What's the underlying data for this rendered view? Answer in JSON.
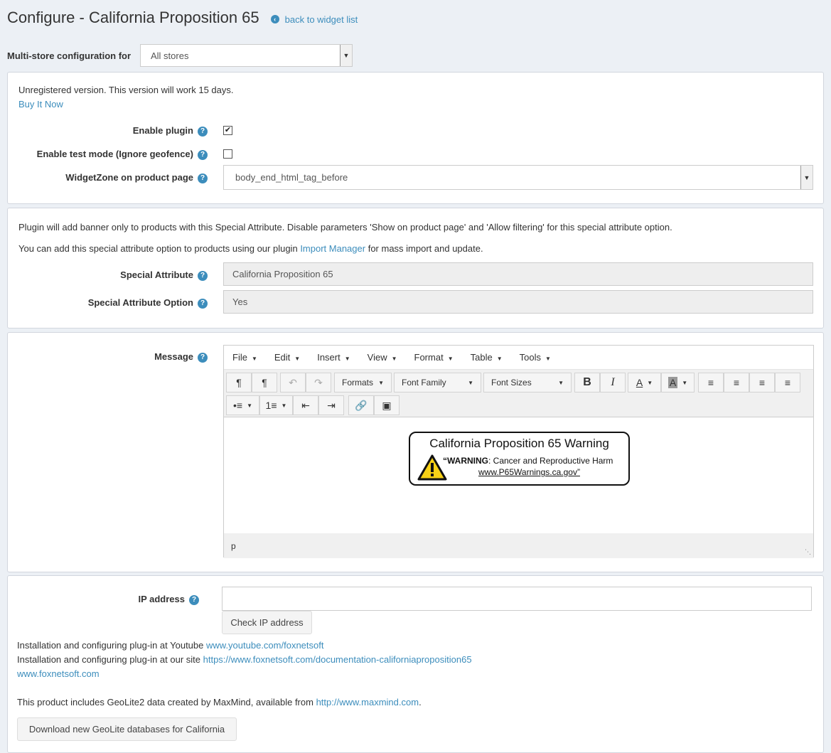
{
  "header": {
    "title": "Configure - California Proposition 65",
    "back_link": "back to widget list"
  },
  "store": {
    "label": "Multi-store configuration for",
    "value": "All stores"
  },
  "general": {
    "unregistered": "Unregistered version. This version will work 15 days.",
    "buy_now": "Buy It Now",
    "enable_plugin_label": "Enable plugin",
    "enable_plugin_checked": true,
    "test_mode_label": "Enable test mode (Ignore geofence)",
    "test_mode_checked": false,
    "widgetzone_label": "WidgetZone on product page",
    "widgetzone_value": "body_end_html_tag_before"
  },
  "attribute": {
    "info1": "Plugin will add banner only to products with this Special Attribute. Disable parameters 'Show on product page' and 'Allow filtering' for this special attribute option.",
    "info2_prefix": "You can add this special attribute option to products using our plugin",
    "info2_link": "Import Manager",
    "info2_suffix": "for mass import and update.",
    "special_attr_label": "Special Attribute",
    "special_attr_value": "California Proposition 65",
    "special_opt_label": "Special Attribute Option",
    "special_opt_value": "Yes"
  },
  "message": {
    "label": "Message",
    "menu": [
      "File",
      "Edit",
      "Insert",
      "View",
      "Format",
      "Table",
      "Tools"
    ],
    "formats": "Formats",
    "font_family": "Font Family",
    "font_sizes": "Font Sizes",
    "warning_title": "California Proposition 65 Warning",
    "warning_bold": "“WARNING",
    "warning_rest": ": Cancer and Reproductive Harm",
    "warning_link": "www.P65Warnings.ca.gov”",
    "status_path": "p"
  },
  "ip": {
    "label": "IP address",
    "value": "",
    "check_button": "Check IP address",
    "youtube_prefix": "Installation and configuring plug-in at Youtube",
    "youtube_link": "www.youtube.com/foxnetsoft",
    "site_prefix": "Installation and configuring plug-in at our site",
    "site_link": "https://www.foxnetsoft.com/documentation-californiaproposition65",
    "home_link": "www.foxnetsoft.com",
    "geolite_prefix": "This product includes GeoLite2 data created by MaxMind, available from",
    "geolite_link": "http://www.maxmind.com",
    "geolite_suffix": ".",
    "download_button": "Download new GeoLite databases for California"
  },
  "colors": {
    "accent": "#3c8dbc",
    "background": "#ecf0f5",
    "warning_yellow": "#f7d117"
  }
}
